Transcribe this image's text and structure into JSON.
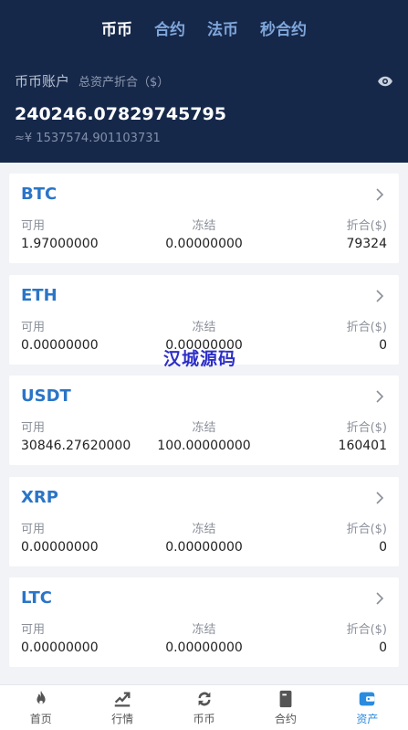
{
  "tabs": [
    {
      "label": "币币",
      "active": true
    },
    {
      "label": "合约",
      "active": false
    },
    {
      "label": "法币",
      "active": false
    },
    {
      "label": "秒合约",
      "active": false
    }
  ],
  "account": {
    "title": "币币账户",
    "subtitle": "总资产折合（$）",
    "total": "240246.07829745795",
    "approx": "≈¥ 1537574.901103731",
    "eye_icon": "eye-icon"
  },
  "column_labels": {
    "available": "可用",
    "frozen": "冻结",
    "converted": "折合($)"
  },
  "coins": [
    {
      "name": "BTC",
      "available": "1.97000000",
      "frozen": "0.00000000",
      "converted": "79324"
    },
    {
      "name": "ETH",
      "available": "0.00000000",
      "frozen": "0.00000000",
      "converted": "0"
    },
    {
      "name": "USDT",
      "available": "30846.27620000",
      "frozen": "100.00000000",
      "converted": "160401"
    },
    {
      "name": "XRP",
      "available": "0.00000000",
      "frozen": "0.00000000",
      "converted": "0"
    },
    {
      "name": "LTC",
      "available": "0.00000000",
      "frozen": "0.00000000",
      "converted": "0"
    }
  ],
  "watermark": "汉城源码",
  "nav": [
    {
      "label": "首页",
      "icon": "fire-icon",
      "active": false
    },
    {
      "label": "行情",
      "icon": "chart-icon",
      "active": false
    },
    {
      "label": "币币",
      "icon": "exchange-icon",
      "active": false
    },
    {
      "label": "合约",
      "icon": "contract-icon",
      "active": false
    },
    {
      "label": "资产",
      "icon": "wallet-icon",
      "active": true
    }
  ],
  "colors": {
    "header_bg": "#16284a",
    "tab_inactive": "#7fa6da",
    "coin_name": "#2a75c7",
    "nav_active": "#2a8ce0",
    "watermark": "#2d2fc9"
  }
}
